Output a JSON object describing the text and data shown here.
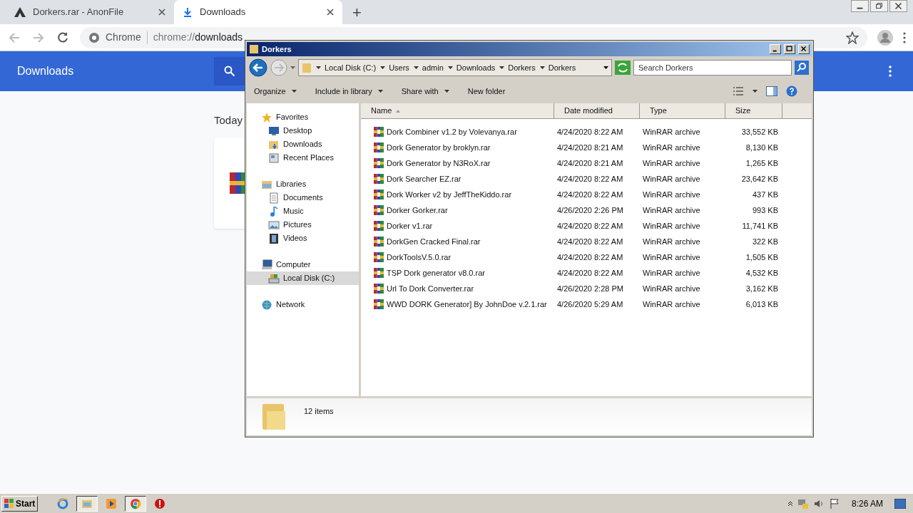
{
  "browser": {
    "tabs": [
      {
        "title": "Dorkers.rar - AnonFile",
        "selected": false
      },
      {
        "title": "Downloads",
        "selected": true
      }
    ],
    "new_tab": "+",
    "address": {
      "label": "Chrome",
      "scheme": "chrome://",
      "path": "downloads"
    }
  },
  "page": {
    "title": "Downloads",
    "section": "Today"
  },
  "explorer": {
    "title": "Dorkers",
    "breadcrumb": [
      "Local Disk (C:)",
      "Users",
      "admin",
      "Downloads",
      "Dorkers",
      "Dorkers"
    ],
    "search": {
      "placeholder": "Search Dorkers"
    },
    "toolbar": [
      "Organize",
      "Include in library",
      "Share with",
      "New folder"
    ],
    "nav": [
      {
        "label": "Favorites",
        "kind": "favorites",
        "selected": false,
        "children": [
          {
            "label": "Desktop",
            "kind": "desktop",
            "selected": false
          },
          {
            "label": "Downloads",
            "kind": "downloads",
            "selected": false
          },
          {
            "label": "Recent Places",
            "kind": "recent",
            "selected": false
          }
        ]
      },
      {
        "label": "Libraries",
        "kind": "libraries",
        "selected": false,
        "children": [
          {
            "label": "Documents",
            "kind": "documents",
            "selected": false
          },
          {
            "label": "Music",
            "kind": "music",
            "selected": false
          },
          {
            "label": "Pictures",
            "kind": "pictures",
            "selected": false
          },
          {
            "label": "Videos",
            "kind": "videos",
            "selected": false
          }
        ]
      },
      {
        "label": "Computer",
        "kind": "computer",
        "selected": false,
        "children": [
          {
            "label": "Local Disk (C:)",
            "kind": "disk",
            "selected": true
          }
        ]
      },
      {
        "label": "Network",
        "kind": "network",
        "selected": false
      }
    ],
    "columns": [
      {
        "label": "Name",
        "sorted": true
      },
      {
        "label": "Date modified",
        "sorted": false
      },
      {
        "label": "Type",
        "sorted": false
      },
      {
        "label": "Size",
        "sorted": false
      }
    ],
    "files": [
      {
        "name": "Dork Combiner v1.2 by Volevanya.rar",
        "date": "4/24/2020 8:22 AM",
        "type": "WinRAR archive",
        "size": "33,552 KB"
      },
      {
        "name": "Dork Generator by broklyn.rar",
        "date": "4/24/2020 8:21 AM",
        "type": "WinRAR archive",
        "size": "8,130 KB"
      },
      {
        "name": "Dork Generator by N3RoX.rar",
        "date": "4/24/2020 8:21 AM",
        "type": "WinRAR archive",
        "size": "1,265 KB"
      },
      {
        "name": "Dork Searcher EZ.rar",
        "date": "4/24/2020 8:22 AM",
        "type": "WinRAR archive",
        "size": "23,642 KB"
      },
      {
        "name": "Dork Worker v2 by JeffTheKiddo.rar",
        "date": "4/24/2020 8:22 AM",
        "type": "WinRAR archive",
        "size": "437 KB"
      },
      {
        "name": "Dorker Gorker.rar",
        "date": "4/26/2020 2:26 PM",
        "type": "WinRAR archive",
        "size": "993 KB"
      },
      {
        "name": "Dorker v1.rar",
        "date": "4/24/2020 8:22 AM",
        "type": "WinRAR archive",
        "size": "11,741 KB"
      },
      {
        "name": "DorkGen Cracked Final.rar",
        "date": "4/24/2020 8:22 AM",
        "type": "WinRAR archive",
        "size": "322 KB"
      },
      {
        "name": "DorkToolsV.5.0.rar",
        "date": "4/24/2020 8:22 AM",
        "type": "WinRAR archive",
        "size": "1,505 KB"
      },
      {
        "name": "TSP Dork generator v8.0.rar",
        "date": "4/24/2020 8:22 AM",
        "type": "WinRAR archive",
        "size": "4,532 KB"
      },
      {
        "name": "Url To Dork Converter.rar",
        "date": "4/26/2020 2:28 PM",
        "type": "WinRAR archive",
        "size": "3,162 KB"
      },
      {
        "name": "WWD DORK Generator] By JohnDoe v.2.1.rar",
        "date": "4/26/2020 5:29 AM",
        "type": "WinRAR archive",
        "size": "6,013 KB"
      }
    ],
    "status": "12 items"
  },
  "taskbar": {
    "start": "Start",
    "apps": [
      {
        "kind": "ie",
        "active": false
      },
      {
        "kind": "explorer",
        "active": true
      },
      {
        "kind": "media",
        "active": false
      },
      {
        "kind": "chrome",
        "active": true
      },
      {
        "kind": "stop",
        "active": false
      }
    ],
    "clock": "8:26 AM"
  }
}
